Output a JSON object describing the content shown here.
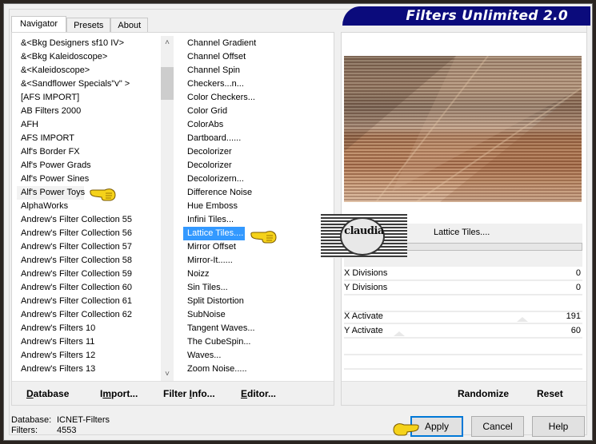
{
  "app": {
    "title": "Filters Unlimited 2.0"
  },
  "tabs": [
    {
      "label": "Navigator",
      "active": true
    },
    {
      "label": "Presets",
      "active": false
    },
    {
      "label": "About",
      "active": false
    }
  ],
  "categories": {
    "items": [
      "&<Bkg Designers sf10 IV>",
      "&<Bkg Kaleidoscope>",
      "&<Kaleidoscope>",
      "&<Sandflower Specials\"v\" >",
      "[AFS IMPORT]",
      "AB Filters 2000",
      "AFH",
      "AFS IMPORT",
      "Alf's Border FX",
      "Alf's Power Grads",
      "Alf's Power Sines",
      "Alf's Power Toys",
      "AlphaWorks",
      "Andrew's Filter Collection 55",
      "Andrew's Filter Collection 56",
      "Andrew's Filter Collection 57",
      "Andrew's Filter Collection 58",
      "Andrew's Filter Collection 59",
      "Andrew's Filter Collection 60",
      "Andrew's Filter Collection 61",
      "Andrew's Filter Collection 62",
      "Andrew's Filters 10",
      "Andrew's Filters 11",
      "Andrew's Filters 12",
      "Andrew's Filters 13"
    ],
    "highlighted": "Alf's Power Toys",
    "scroll_up_icon": "chevron-up-icon",
    "scroll_down_icon": "chevron-down-icon"
  },
  "filters": {
    "items": [
      "Channel Gradient",
      "Channel Offset",
      "Channel Spin",
      "Checkers...n...",
      "Color Checkers...",
      "Color Grid",
      "ColorAbs",
      "Dartboard......",
      "Decolorizer",
      "Decolorizer",
      "Decolorizern...",
      "Difference Noise",
      "Hue Emboss",
      "Infini Tiles...",
      "Lattice Tiles....",
      "Mirror Offset",
      "Mirror-It......",
      "Noizz",
      "Sin Tiles...",
      "Split Distortion",
      "SubNoise",
      "Tangent Waves...",
      "The CubeSpin...",
      "Waves...",
      "Zoom Noise....."
    ],
    "selected": "Lattice Tiles...."
  },
  "left_buttons": {
    "database": "Database",
    "import": "Import...",
    "filter_info": "Filter Info...",
    "editor": "Editor..."
  },
  "effect": {
    "name": "Lattice Tiles....",
    "params": [
      {
        "label": "X Divisions",
        "value": "0"
      },
      {
        "label": "Y Divisions",
        "value": "0"
      },
      {
        "label": "X Activate",
        "value": "191"
      },
      {
        "label": "Y Activate",
        "value": "60"
      }
    ]
  },
  "right_buttons": {
    "randomize": "Randomize",
    "reset": "Reset"
  },
  "status": {
    "database_label": "Database:",
    "database_value": "ICNET-Filters",
    "filters_label": "Filters:",
    "filters_value": "4553"
  },
  "dialog_buttons": {
    "apply": "Apply",
    "cancel": "Cancel",
    "help": "Help"
  },
  "watermark": {
    "text": "claudia"
  },
  "colors": {
    "banner": "#0b0b7c",
    "selection": "#3399ff",
    "default_button_border": "#0078d7"
  }
}
